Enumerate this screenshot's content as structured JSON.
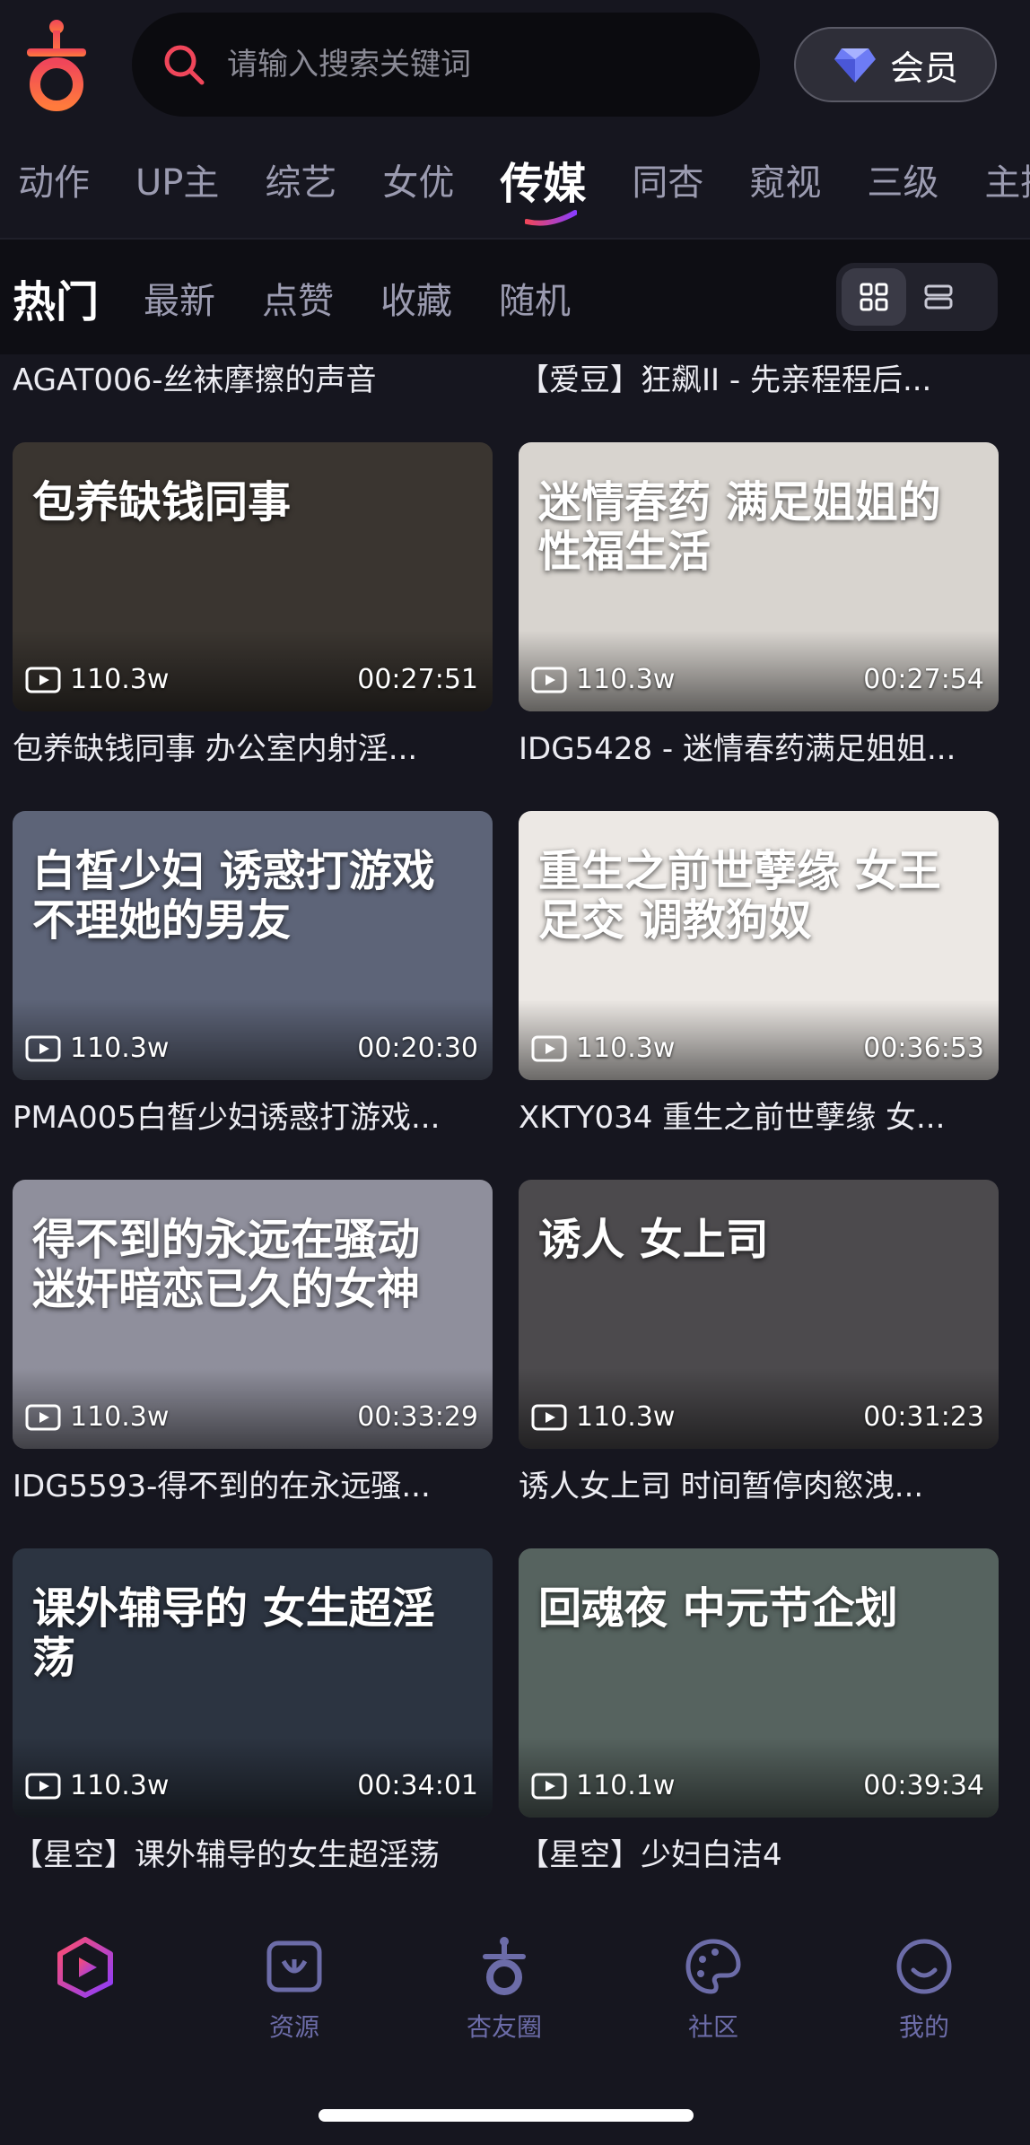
{
  "search": {
    "placeholder": "请输入搜索关键词"
  },
  "vip": {
    "label": "会员"
  },
  "category_tabs": [
    "动作",
    "UP主",
    "综艺",
    "女优",
    "传媒",
    "同杏",
    "窥视",
    "三级",
    "主播"
  ],
  "active_category": "传媒",
  "sort_tabs": [
    "热门",
    "最新",
    "点赞",
    "收藏",
    "随机"
  ],
  "active_sort": "热门",
  "view_modes": [
    "grid-icon",
    "list-icon"
  ],
  "partial_row": [
    "AGAT006-丝袜摩擦的声音",
    "【爱豆】狂飙II - 先亲程程后..."
  ],
  "videos": [
    {
      "title": "包养缺钱同事  办公室内射淫...",
      "views": "110.3w",
      "duration": "00:27:51",
      "thumb_text": "包养缺钱同事",
      "bg": "#3a3530"
    },
    {
      "title": "IDG5428 - 迷情春药满足姐姐...",
      "views": "110.3w",
      "duration": "00:27:54",
      "thumb_text": "迷情春药 满足姐姐的 性福生活",
      "bg": "#d8d4cf"
    },
    {
      "title": "PMA005白皙少妇诱惑打游戏...",
      "views": "110.3w",
      "duration": "00:20:30",
      "thumb_text": "白皙少妇 诱惑打游戏 不理她的男友",
      "bg": "#5d6478"
    },
    {
      "title": "XKTY034 重生之前世孽缘  女...",
      "views": "110.3w",
      "duration": "00:36:53",
      "thumb_text": "重生之前世孽缘 女王足交 调教狗奴",
      "bg": "#ece8e4"
    },
    {
      "title": "IDG5593-得不到的在永远骚...",
      "views": "110.3w",
      "duration": "00:33:29",
      "thumb_text": "得不到的永远在骚动 迷奸暗恋已久的女神",
      "bg": "#8f8f9c"
    },
    {
      "title": "诱人女上司  时间暂停肉慾洩...",
      "views": "110.3w",
      "duration": "00:31:23",
      "thumb_text": "诱人 女上司",
      "bg": "#4c4a4d"
    },
    {
      "title": "【星空】课外辅导的女生超淫荡",
      "views": "110.3w",
      "duration": "00:34:01",
      "thumb_text": "课外辅导的 女生超淫荡",
      "bg": "#2c3441"
    },
    {
      "title": "【星空】少妇白洁4",
      "views": "110.1w",
      "duration": "00:39:34",
      "thumb_text": "回魂夜 中元节企划",
      "bg": "#56635f"
    }
  ],
  "bottom_nav": [
    {
      "label": "",
      "icon": "play-icon"
    },
    {
      "label": "资源",
      "icon": "resource-icon"
    },
    {
      "label": "杏友圈",
      "icon": "apricot-icon"
    },
    {
      "label": "社区",
      "icon": "palette-icon"
    },
    {
      "label": "我的",
      "icon": "smile-icon"
    }
  ],
  "colors": {
    "accent": "#f0465a",
    "accent2": "#ff7a3c",
    "nav_inactive": "#6c6ca8",
    "background": "#16161f"
  }
}
